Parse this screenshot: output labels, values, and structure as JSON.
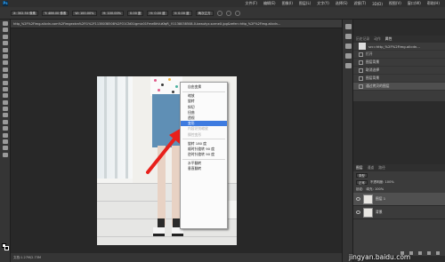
{
  "app": {
    "logo": "Ps"
  },
  "menubar": {
    "items": [
      "文件(F)",
      "编辑(E)",
      "图像(I)",
      "图层(L)",
      "文字(Y)",
      "选择(S)",
      "滤镜(T)",
      "3D(D)",
      "视图(V)",
      "窗口(W)",
      "帮助(H)"
    ]
  },
  "options": {
    "x": "X: 302.50 像素",
    "y": "Y: 486.00 像素",
    "w": "W: 100.00%",
    "h": "H: 100.00%",
    "angle": "0.00 度",
    "hskew": "H: 0.00 度",
    "vskew": "V: 0.00 度",
    "interp": "两次立方"
  },
  "document": {
    "tab": "http_%2F%2Fimg.alicdn.com%2Fimgextra%2Fi1%2F1138038508%2FO1CN01igmic01FmeBhVuKfqR_!!1138038508-0-beautyx.sceneX.jpg&refer=http_%2F%2Fimg.alicdn...",
    "status": "文档:1.27M/2.73M"
  },
  "context_menu": {
    "items": [
      {
        "label": "自由变换",
        "state": "normal"
      },
      {
        "sep": true
      },
      {
        "label": "缩放",
        "state": "normal"
      },
      {
        "label": "旋转",
        "state": "normal"
      },
      {
        "label": "斜切",
        "state": "normal"
      },
      {
        "label": "扭曲",
        "state": "normal"
      },
      {
        "label": "透视",
        "state": "normal"
      },
      {
        "label": "变形",
        "state": "selected"
      },
      {
        "label": "内容识别缩放",
        "state": "disabled"
      },
      {
        "label": "操控变形",
        "state": "disabled"
      },
      {
        "sep": true
      },
      {
        "label": "旋转 180 度",
        "state": "normal"
      },
      {
        "label": "顺时针旋转 90 度",
        "state": "normal"
      },
      {
        "label": "逆时针旋转 90 度",
        "state": "normal"
      },
      {
        "sep": true
      },
      {
        "label": "水平翻转",
        "state": "normal"
      },
      {
        "label": "垂直翻转",
        "state": "normal"
      }
    ]
  },
  "history_panel": {
    "tabs": [
      "历史记录",
      "动作",
      "属性"
    ],
    "snapshot": "src=http_%2F%2Fimg.alicdn...",
    "rows": [
      "打开",
      "图层背景",
      "取消选择",
      "图层背景",
      "通过拷贝的图层"
    ]
  },
  "layers_panel": {
    "tabs": [
      "图层",
      "通道",
      "路径"
    ],
    "filter": "类型",
    "blend_mode": "正常",
    "opacity": "不透明度: 100%",
    "lock": "锁定:",
    "fill": "填充: 100%",
    "layers": [
      {
        "name": "图层 1",
        "selected": true
      },
      {
        "name": "背景",
        "selected": false
      }
    ]
  },
  "watermark": "jingyan.baidu.com"
}
